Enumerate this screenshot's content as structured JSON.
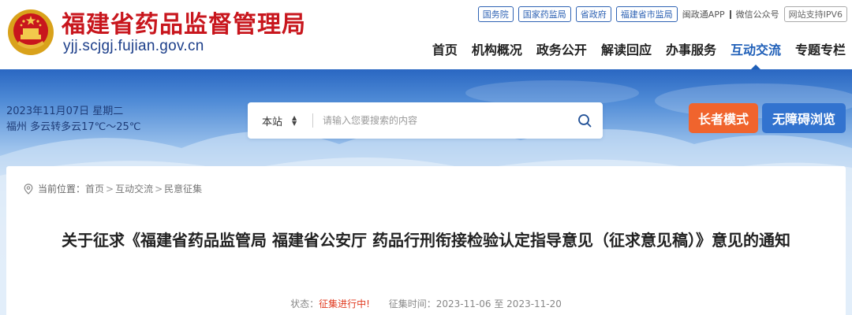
{
  "header": {
    "site_name": "福建省药品监督管理局",
    "site_domain": "yjj.scjgj.fujian.gov.cn",
    "top_links": [
      "国务院",
      "国家药监局",
      "省政府",
      "福建省市监局"
    ],
    "app_link": "闽政通APP",
    "wechat_link": "微信公众号",
    "ipv6_badge": "网站支持IPV6"
  },
  "nav": {
    "items": [
      "首页",
      "机构概况",
      "政务公开",
      "解读回应",
      "办事服务",
      "互动交流",
      "专题专栏"
    ],
    "active": "互动交流"
  },
  "banner": {
    "date": "2023年11月07日 星期二",
    "weather": "福州 多云转多云17℃～25℃",
    "search": {
      "scope": "本站",
      "placeholder": "请输入您要搜索的内容"
    },
    "elder_mode": "长者模式",
    "accessibility": "无障碍浏览"
  },
  "breadcrumb": {
    "label": "当前位置：",
    "items": [
      "首页",
      "互动交流",
      "民意征集"
    ]
  },
  "article": {
    "title": "关于征求《福建省药品监管局 福建省公安厅 药品行刑衔接检验认定指导意见（征求意见稿）》意见的通知",
    "status_label": "状态：",
    "status_value": "征集进行中!",
    "period_label": "征集时间：",
    "period_start": "2023-11-06",
    "period_sep": "至",
    "period_end": "2023-11-20"
  },
  "colors": {
    "brand_red": "#c8161d",
    "nav_active": "#1f5fb8",
    "elder_btn": "#f0642d",
    "access_btn": "#3273cf",
    "status_red": "#e03a1f"
  },
  "icons": [
    "national-emblem-icon",
    "search-icon",
    "location-pin-icon",
    "updown-arrows-icon"
  ]
}
